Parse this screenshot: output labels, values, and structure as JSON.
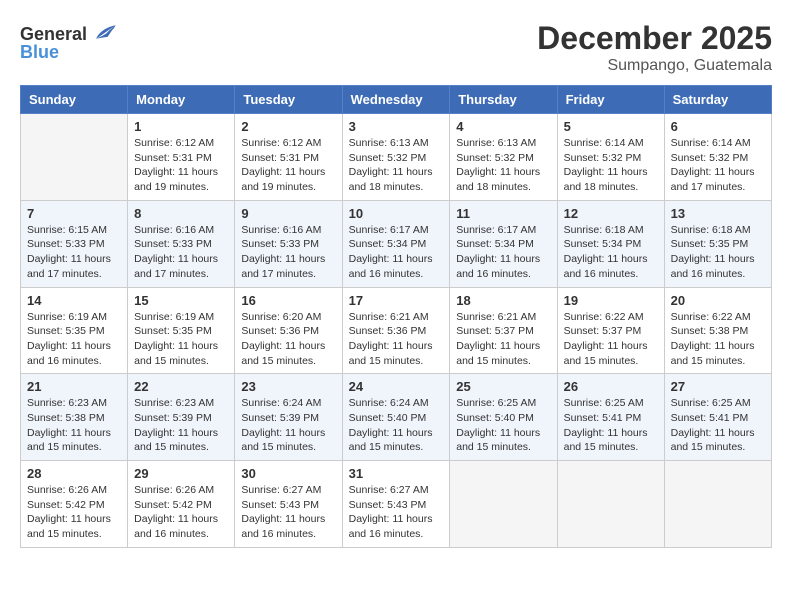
{
  "header": {
    "logo": {
      "general": "General",
      "blue": "Blue"
    },
    "title": "December 2025",
    "location": "Sumpango, Guatemala"
  },
  "calendar": {
    "columns": [
      "Sunday",
      "Monday",
      "Tuesday",
      "Wednesday",
      "Thursday",
      "Friday",
      "Saturday"
    ],
    "weeks": [
      [
        {
          "day": "",
          "info": ""
        },
        {
          "day": "1",
          "info": "Sunrise: 6:12 AM\nSunset: 5:31 PM\nDaylight: 11 hours\nand 19 minutes."
        },
        {
          "day": "2",
          "info": "Sunrise: 6:12 AM\nSunset: 5:31 PM\nDaylight: 11 hours\nand 19 minutes."
        },
        {
          "day": "3",
          "info": "Sunrise: 6:13 AM\nSunset: 5:32 PM\nDaylight: 11 hours\nand 18 minutes."
        },
        {
          "day": "4",
          "info": "Sunrise: 6:13 AM\nSunset: 5:32 PM\nDaylight: 11 hours\nand 18 minutes."
        },
        {
          "day": "5",
          "info": "Sunrise: 6:14 AM\nSunset: 5:32 PM\nDaylight: 11 hours\nand 18 minutes."
        },
        {
          "day": "6",
          "info": "Sunrise: 6:14 AM\nSunset: 5:32 PM\nDaylight: 11 hours\nand 17 minutes."
        }
      ],
      [
        {
          "day": "7",
          "info": "Sunrise: 6:15 AM\nSunset: 5:33 PM\nDaylight: 11 hours\nand 17 minutes."
        },
        {
          "day": "8",
          "info": "Sunrise: 6:16 AM\nSunset: 5:33 PM\nDaylight: 11 hours\nand 17 minutes."
        },
        {
          "day": "9",
          "info": "Sunrise: 6:16 AM\nSunset: 5:33 PM\nDaylight: 11 hours\nand 17 minutes."
        },
        {
          "day": "10",
          "info": "Sunrise: 6:17 AM\nSunset: 5:34 PM\nDaylight: 11 hours\nand 16 minutes."
        },
        {
          "day": "11",
          "info": "Sunrise: 6:17 AM\nSunset: 5:34 PM\nDaylight: 11 hours\nand 16 minutes."
        },
        {
          "day": "12",
          "info": "Sunrise: 6:18 AM\nSunset: 5:34 PM\nDaylight: 11 hours\nand 16 minutes."
        },
        {
          "day": "13",
          "info": "Sunrise: 6:18 AM\nSunset: 5:35 PM\nDaylight: 11 hours\nand 16 minutes."
        }
      ],
      [
        {
          "day": "14",
          "info": "Sunrise: 6:19 AM\nSunset: 5:35 PM\nDaylight: 11 hours\nand 16 minutes."
        },
        {
          "day": "15",
          "info": "Sunrise: 6:19 AM\nSunset: 5:35 PM\nDaylight: 11 hours\nand 15 minutes."
        },
        {
          "day": "16",
          "info": "Sunrise: 6:20 AM\nSunset: 5:36 PM\nDaylight: 11 hours\nand 15 minutes."
        },
        {
          "day": "17",
          "info": "Sunrise: 6:21 AM\nSunset: 5:36 PM\nDaylight: 11 hours\nand 15 minutes."
        },
        {
          "day": "18",
          "info": "Sunrise: 6:21 AM\nSunset: 5:37 PM\nDaylight: 11 hours\nand 15 minutes."
        },
        {
          "day": "19",
          "info": "Sunrise: 6:22 AM\nSunset: 5:37 PM\nDaylight: 11 hours\nand 15 minutes."
        },
        {
          "day": "20",
          "info": "Sunrise: 6:22 AM\nSunset: 5:38 PM\nDaylight: 11 hours\nand 15 minutes."
        }
      ],
      [
        {
          "day": "21",
          "info": "Sunrise: 6:23 AM\nSunset: 5:38 PM\nDaylight: 11 hours\nand 15 minutes."
        },
        {
          "day": "22",
          "info": "Sunrise: 6:23 AM\nSunset: 5:39 PM\nDaylight: 11 hours\nand 15 minutes."
        },
        {
          "day": "23",
          "info": "Sunrise: 6:24 AM\nSunset: 5:39 PM\nDaylight: 11 hours\nand 15 minutes."
        },
        {
          "day": "24",
          "info": "Sunrise: 6:24 AM\nSunset: 5:40 PM\nDaylight: 11 hours\nand 15 minutes."
        },
        {
          "day": "25",
          "info": "Sunrise: 6:25 AM\nSunset: 5:40 PM\nDaylight: 11 hours\nand 15 minutes."
        },
        {
          "day": "26",
          "info": "Sunrise: 6:25 AM\nSunset: 5:41 PM\nDaylight: 11 hours\nand 15 minutes."
        },
        {
          "day": "27",
          "info": "Sunrise: 6:25 AM\nSunset: 5:41 PM\nDaylight: 11 hours\nand 15 minutes."
        }
      ],
      [
        {
          "day": "28",
          "info": "Sunrise: 6:26 AM\nSunset: 5:42 PM\nDaylight: 11 hours\nand 15 minutes."
        },
        {
          "day": "29",
          "info": "Sunrise: 6:26 AM\nSunset: 5:42 PM\nDaylight: 11 hours\nand 16 minutes."
        },
        {
          "day": "30",
          "info": "Sunrise: 6:27 AM\nSunset: 5:43 PM\nDaylight: 11 hours\nand 16 minutes."
        },
        {
          "day": "31",
          "info": "Sunrise: 6:27 AM\nSunset: 5:43 PM\nDaylight: 11 hours\nand 16 minutes."
        },
        {
          "day": "",
          "info": ""
        },
        {
          "day": "",
          "info": ""
        },
        {
          "day": "",
          "info": ""
        }
      ]
    ]
  }
}
